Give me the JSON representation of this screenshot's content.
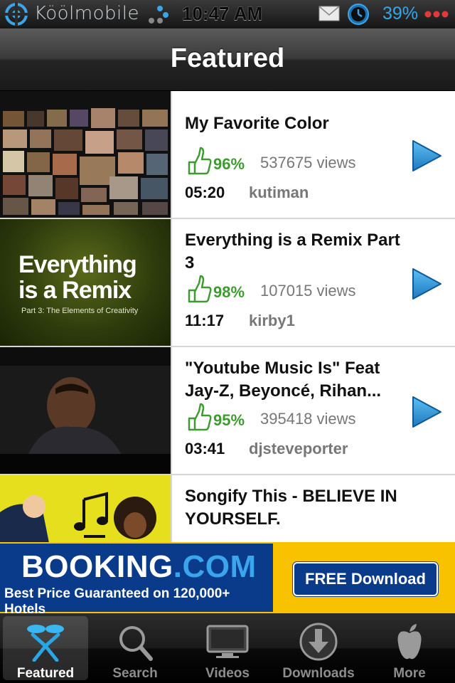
{
  "status_bar": {
    "carrier": "Köölmobile",
    "time": "10:47 AM",
    "battery": "39%"
  },
  "nav": {
    "title": "Featured"
  },
  "videos": [
    {
      "title": "My Favorite Color",
      "rating": "96%",
      "views": "537675 views",
      "duration": "05:20",
      "author": "kutiman"
    },
    {
      "title": "Everything is a Remix Part 3",
      "rating": "98%",
      "views": "107015 views",
      "duration": "11:17",
      "author": "kirby1",
      "thumb_title": "Everything is a Remix",
      "thumb_subtitle": "Part 3: The Elements of Creativity"
    },
    {
      "title": "\"Youtube Music Is\" Feat Jay-Z, Beyoncé, Rihan...",
      "rating": "95%",
      "views": "395418 views",
      "duration": "03:41",
      "author": "djsteveporter"
    },
    {
      "title": "Songify This - BELIEVE IN YOURSELF."
    }
  ],
  "ad": {
    "brand_main": "BOOKING",
    "brand_suffix": ".COM",
    "tagline": "Best Price Guaranteed on 120,000+ Hotels",
    "cta": "FREE Download",
    "colors": {
      "blue": "#0a3a8a",
      "yellow": "#f8c200",
      "accent": "#3aa4ec"
    }
  },
  "tabs": [
    {
      "label": "Featured",
      "icon": "featured-icon",
      "active": true
    },
    {
      "label": "Search",
      "icon": "search-icon"
    },
    {
      "label": "Videos",
      "icon": "monitor-icon"
    },
    {
      "label": "Downloads",
      "icon": "download-icon"
    },
    {
      "label": "More",
      "icon": "apple-icon"
    }
  ],
  "colors": {
    "rating_green": "#3d9b2f",
    "play_blue": "#2f9be0",
    "battery_blue": "#35a7e6"
  }
}
